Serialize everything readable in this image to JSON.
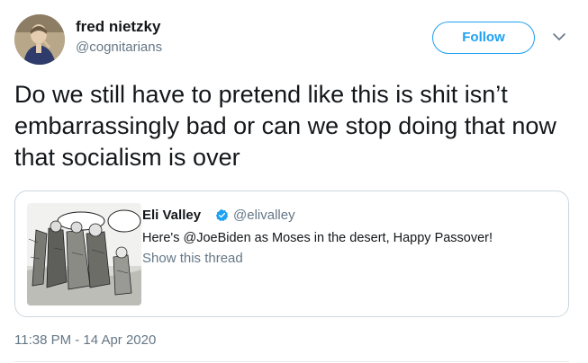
{
  "author": {
    "name": "fred nietzky",
    "handle": "@cognitarians"
  },
  "follow_label": "Follow",
  "tweet_text": "Do we still have to pretend like this is shit isn’t embarrassingly bad or can we stop doing that now that socialism is over",
  "quoted": {
    "name": "Eli Valley",
    "handle": "@elivalley",
    "text": "Here's @JoeBiden as Moses in the desert, Happy Passover!",
    "show_thread": "Show this thread"
  },
  "timestamp": "11:38 PM - 14 Apr 2020",
  "colors": {
    "accent": "#1da1f2",
    "muted": "#657786",
    "border": "#ccd6dd"
  },
  "icons": {
    "menu": "chevron-down-icon",
    "verified": "verified-badge-icon"
  }
}
